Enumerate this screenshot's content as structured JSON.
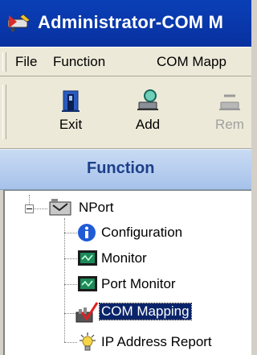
{
  "window": {
    "title": "Administrator-COM M",
    "title_color": "#0a3fb7"
  },
  "menu": {
    "items": [
      "File",
      "Function",
      "COM Mapp"
    ]
  },
  "toolbar": {
    "exit_label": "Exit",
    "add_label": "Add",
    "remove_label": "Rem"
  },
  "section": {
    "title": "Function"
  },
  "tree": {
    "root": "NPort",
    "children": [
      {
        "label": "Configuration",
        "icon": "info-icon"
      },
      {
        "label": "Monitor",
        "icon": "monitor-icon"
      },
      {
        "label": "Port Monitor",
        "icon": "port-monitor-icon"
      },
      {
        "label": "COM Mapping",
        "icon": "com-mapping-icon",
        "selected": true
      },
      {
        "label": "IP Address Report",
        "icon": "ip-report-icon"
      }
    ],
    "selected_color": "#0a246a"
  }
}
